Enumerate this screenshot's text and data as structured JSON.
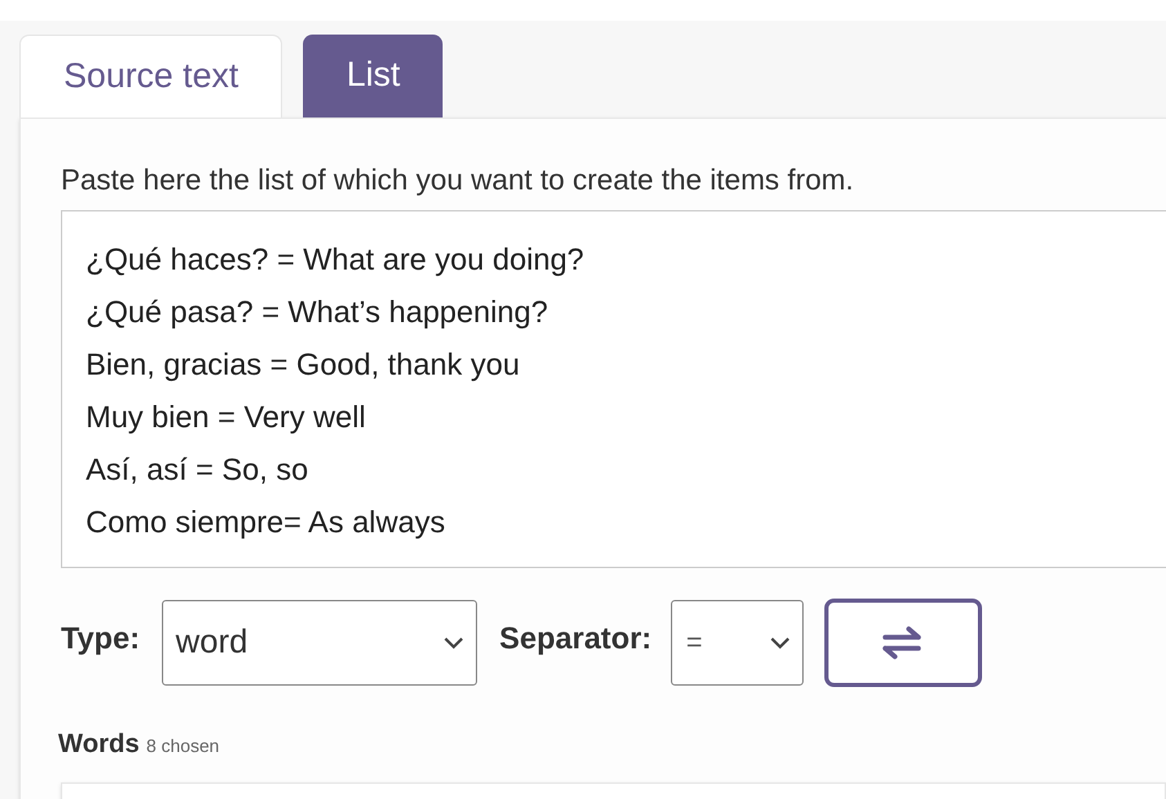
{
  "tabs": [
    {
      "label": "Source text",
      "selected": false
    },
    {
      "label": "List",
      "selected": true
    }
  ],
  "instruction": "Paste here the list of which you want to create the items from.",
  "list_lines": [
    "¿Qué haces? = What are you doing?",
    "¿Qué pasa? = What’s happening?",
    "Bien, gracias = Good, thank you",
    "Muy bien = Very well",
    "Así, así = So, so",
    "Como siempre= As always"
  ],
  "type_label": "Type:",
  "type_value": "word",
  "separator_label": "Separator:",
  "separator_value": "=",
  "words_heading": "Words",
  "words_count": "8 chosen"
}
